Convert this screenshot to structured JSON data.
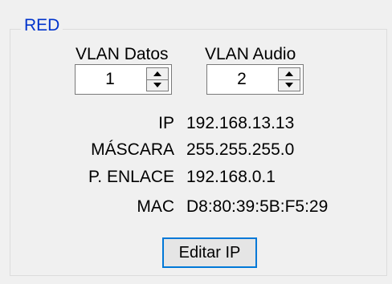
{
  "network_group": {
    "title": "RED",
    "vlan_data": {
      "label": "VLAN Datos",
      "value": "1"
    },
    "vlan_audio": {
      "label": "VLAN Audio",
      "value": "2"
    },
    "info": {
      "ip_label": "IP",
      "ip_value": "192.168.13.13",
      "mask_label": "MÁSCARA",
      "mask_value": "255.255.255.0",
      "gateway_label": "P. ENLACE",
      "gateway_value": "192.168.0.1",
      "mac_label": "MAC",
      "mac_value": "D8:80:39:5B:F5:29"
    },
    "edit_button_label": "Editar IP"
  },
  "icons": {
    "spin_up": "triangle-up-icon",
    "spin_down": "triangle-down-icon"
  },
  "colors": {
    "group_title": "#0033cc",
    "focus_border": "#0078d7"
  }
}
